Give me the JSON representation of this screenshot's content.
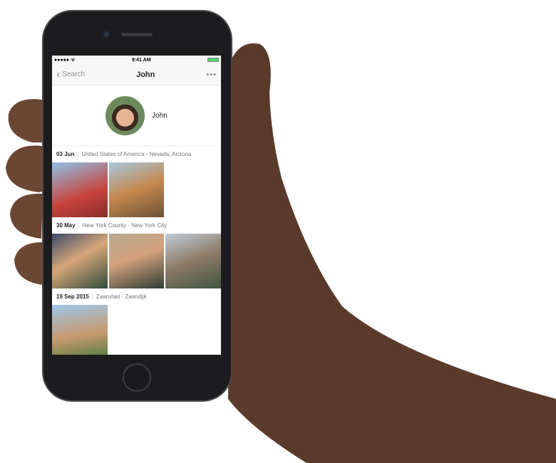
{
  "status": {
    "time": "9:41 AM",
    "signal": "signal-dots",
    "wifi": "wifi-icon",
    "battery_color": "#4cd964"
  },
  "nav": {
    "back_label": "Search",
    "title": "John",
    "more": "•••"
  },
  "profile": {
    "name": "John"
  },
  "sections": [
    {
      "date": "03 Jun",
      "place": "United States of America - Nevada, Arizona",
      "photos": 2
    },
    {
      "date": "30 May",
      "place": "New York County - New York City",
      "photos": 3
    },
    {
      "date": "19 Sep 2015",
      "place": "Zaanstad - Zaandijk",
      "photos": 1
    }
  ]
}
